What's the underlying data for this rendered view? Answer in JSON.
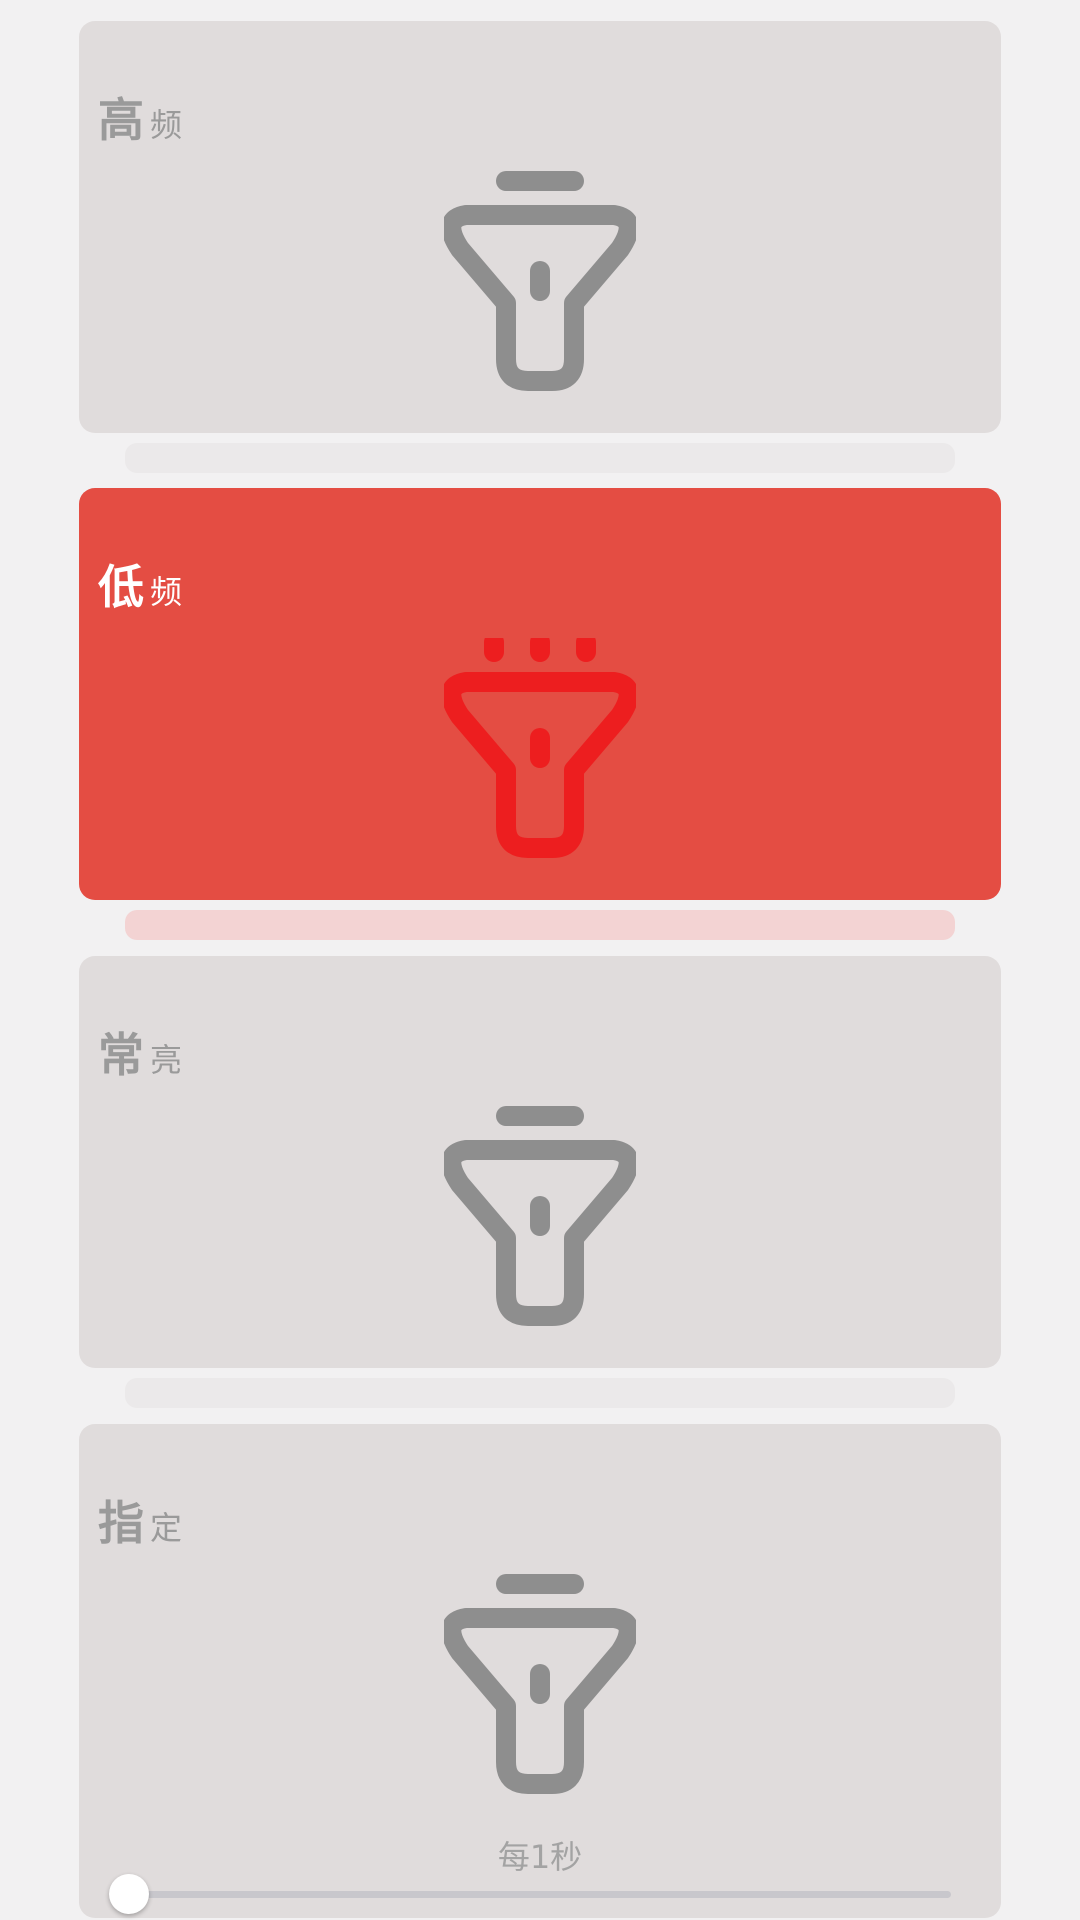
{
  "colors": {
    "background": "#f2f1f2",
    "card_inactive": "#e0dcdc",
    "card_active": "#e44d43",
    "icon_inactive": "#8e8e8e",
    "icon_active": "#ed1e1f",
    "label_inactive": "#9a9a9a",
    "label_active": "#ffffff"
  },
  "modes": [
    {
      "big": "高",
      "small": "频",
      "active": false,
      "icon": "flashlight-icon"
    },
    {
      "big": "低",
      "small": "频",
      "active": true,
      "icon": "flashlight-on-icon"
    },
    {
      "big": "常",
      "small": "亮",
      "active": false,
      "icon": "flashlight-icon"
    },
    {
      "big": "指",
      "small": "定",
      "active": false,
      "icon": "flashlight-icon"
    }
  ],
  "custom": {
    "speed_label": "每1秒",
    "slider_value": 0
  }
}
